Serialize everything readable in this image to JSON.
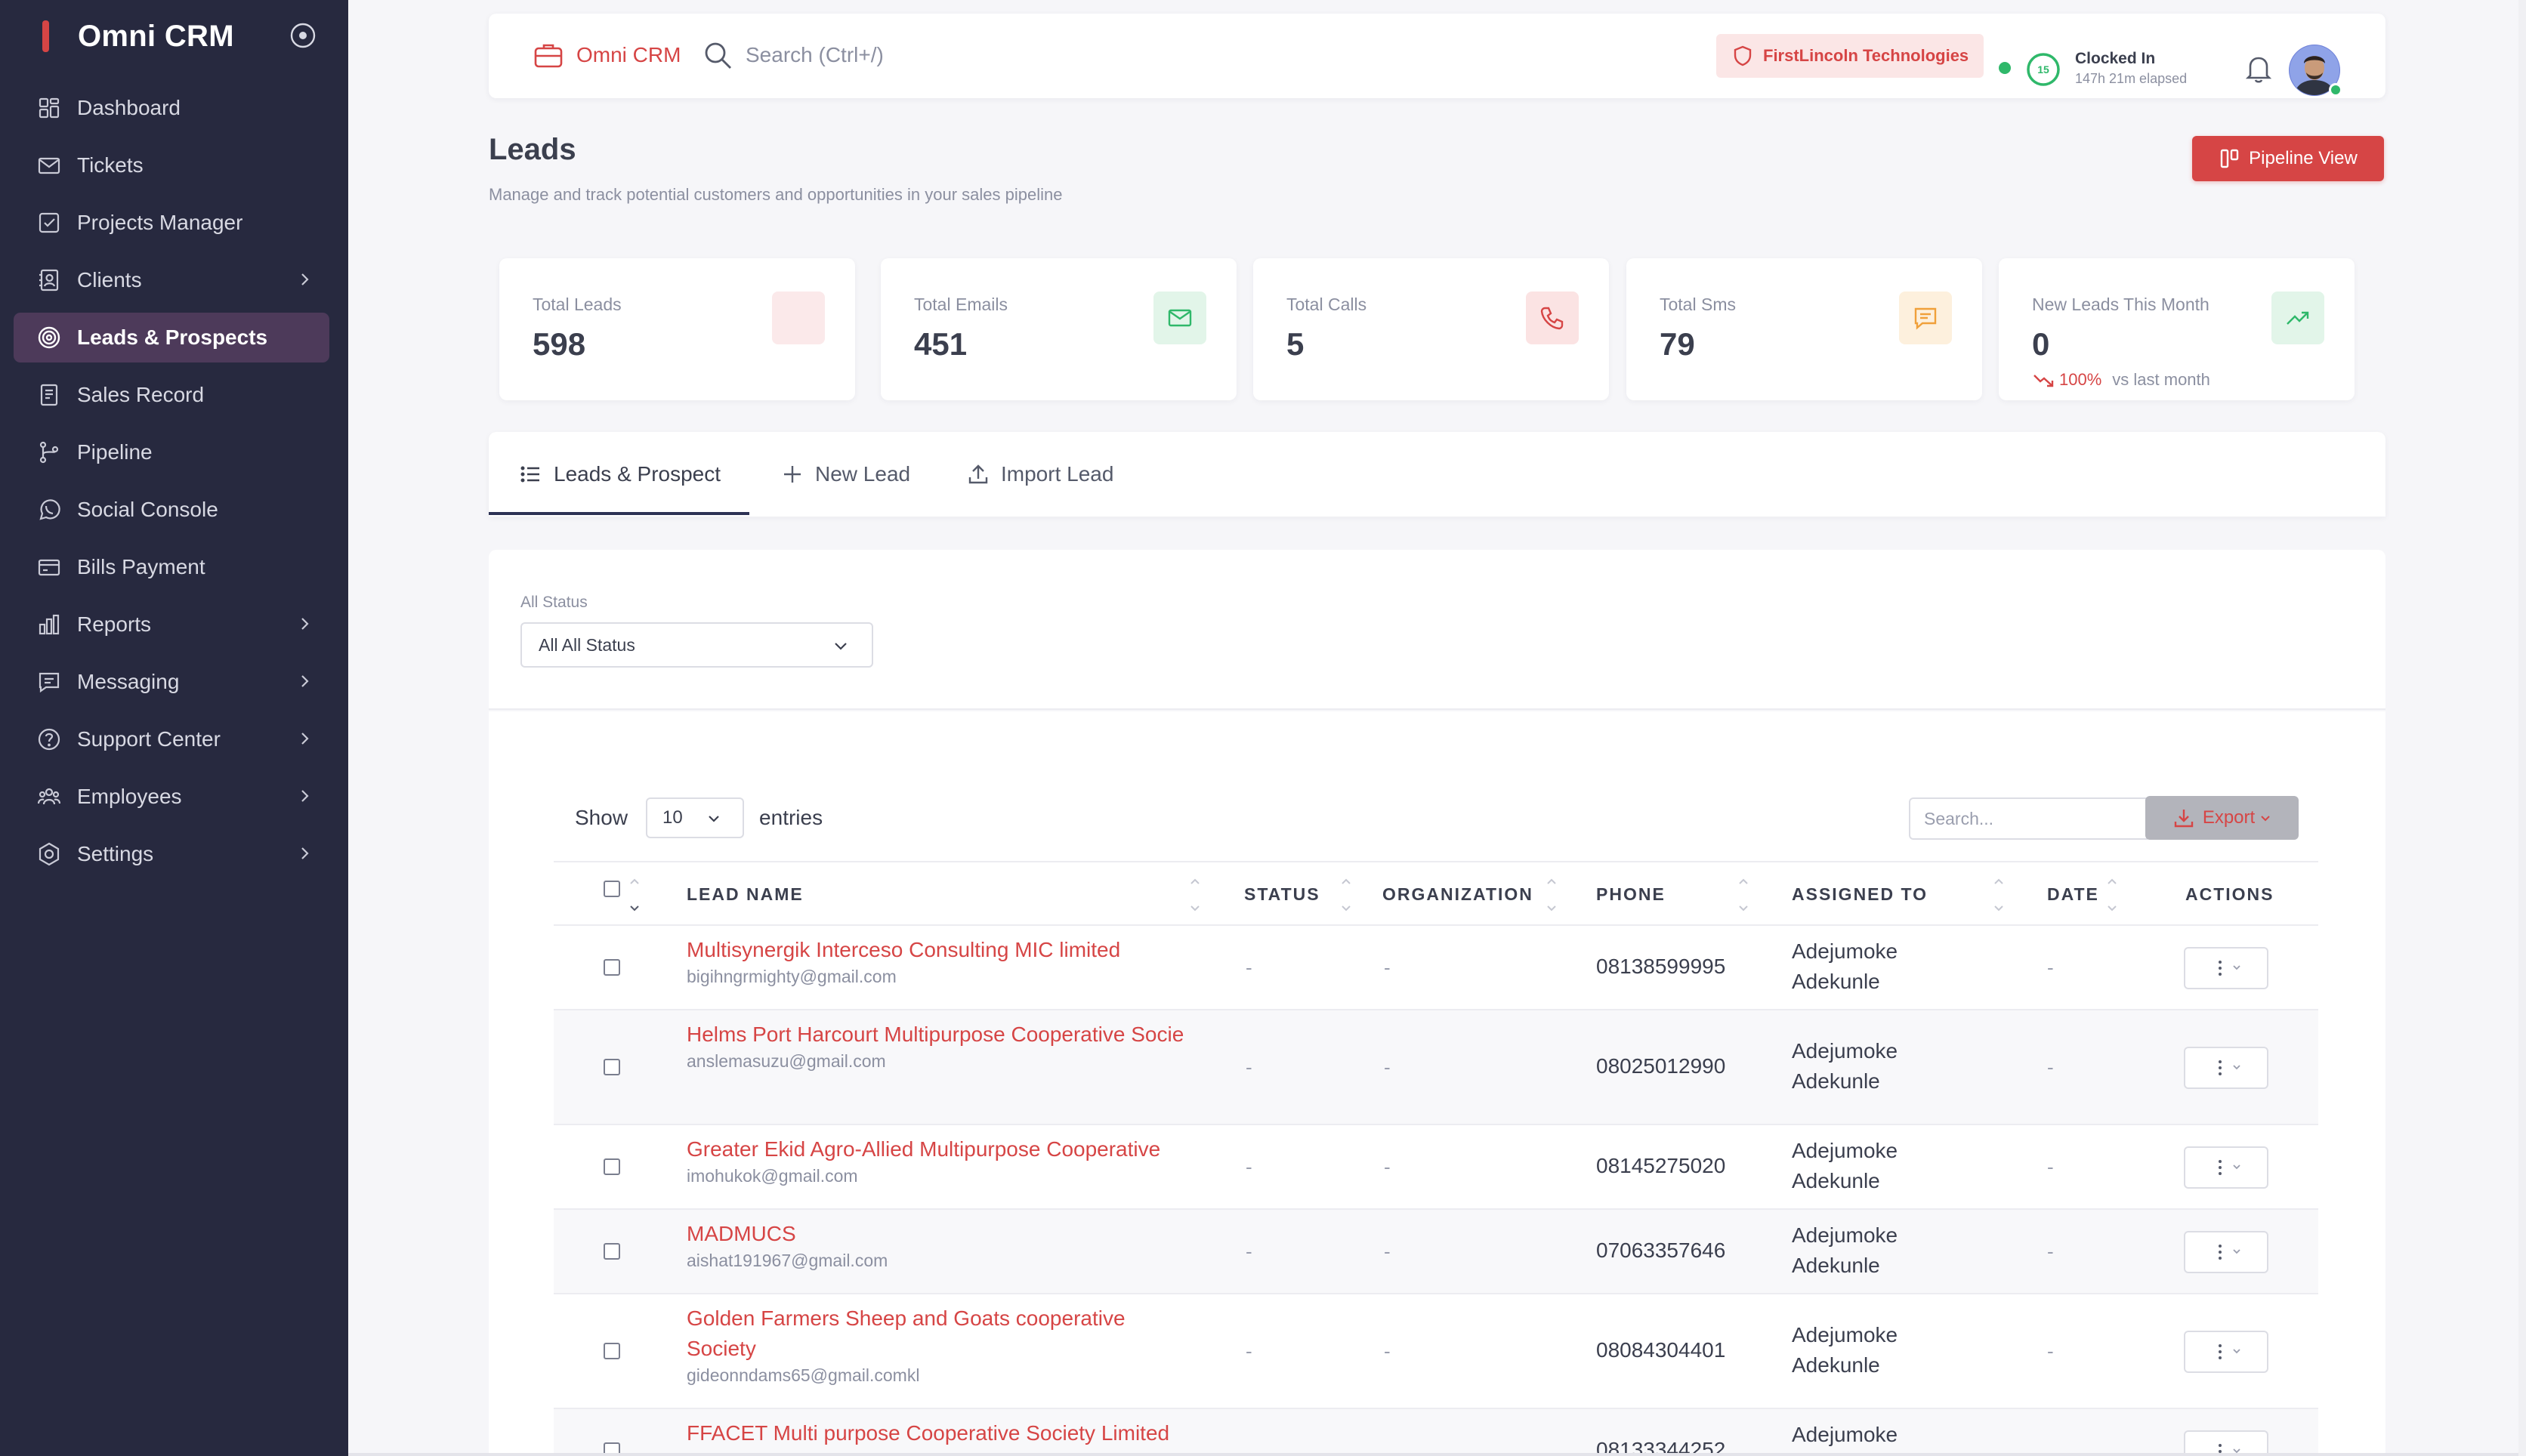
{
  "sidebar": {
    "brand": "Omni CRM",
    "items": [
      {
        "label": "Dashboard",
        "icon": "dashboard-icon",
        "chevron": false,
        "active": false
      },
      {
        "label": "Tickets",
        "icon": "mail-icon",
        "chevron": false,
        "active": false
      },
      {
        "label": "Projects Manager",
        "icon": "checklist-icon",
        "chevron": false,
        "active": false
      },
      {
        "label": "Clients",
        "icon": "contacts-icon",
        "chevron": true,
        "active": false
      },
      {
        "label": "Leads & Prospects",
        "icon": "target-icon",
        "chevron": false,
        "active": true
      },
      {
        "label": "Sales Record",
        "icon": "receipt-icon",
        "chevron": false,
        "active": false
      },
      {
        "label": "Pipeline",
        "icon": "git-branch-icon",
        "chevron": false,
        "active": false
      },
      {
        "label": "Social Console",
        "icon": "whatsapp-icon",
        "chevron": false,
        "active": false
      },
      {
        "label": "Bills Payment",
        "icon": "credit-card-icon",
        "chevron": false,
        "active": false
      },
      {
        "label": "Reports",
        "icon": "bar-chart-icon",
        "chevron": true,
        "active": false
      },
      {
        "label": "Messaging",
        "icon": "message-icon",
        "chevron": true,
        "active": false
      },
      {
        "label": "Support Center",
        "icon": "help-icon",
        "chevron": true,
        "active": false
      },
      {
        "label": "Employees",
        "icon": "users-icon",
        "chevron": true,
        "active": false
      },
      {
        "label": "Settings",
        "icon": "gear-icon",
        "chevron": true,
        "active": false
      }
    ]
  },
  "topbar": {
    "brand": "Omni CRM",
    "search_placeholder": "Search (Ctrl+/)",
    "org": "FirstLincoln Technologies",
    "clock_count": "15",
    "clock_title": "Clocked In",
    "clock_elapsed": "147h 21m elapsed"
  },
  "page": {
    "title": "Leads",
    "subtitle": "Manage and track potential customers and opportunities in your sales pipeline",
    "pipeline_button": "Pipeline View"
  },
  "stats": [
    {
      "label": "Total Leads",
      "value": "598",
      "icon": "blank-icon",
      "bg": "#fbe9ea",
      "fg": "#d64545"
    },
    {
      "label": "Total Emails",
      "value": "451",
      "icon": "mail-icon",
      "bg": "#e2f5e9",
      "fg": "#2fb86a"
    },
    {
      "label": "Total Calls",
      "value": "5",
      "icon": "phone-icon",
      "bg": "#fbe3e3",
      "fg": "#d64545"
    },
    {
      "label": "Total Sms",
      "value": "79",
      "icon": "chat-icon",
      "bg": "#fdf0dd",
      "fg": "#f0a03a"
    },
    {
      "label": "New Leads This Month",
      "value": "0",
      "icon": "trending-up-icon",
      "bg": "#e2f5e9",
      "fg": "#2fb86a",
      "trend_pct": "100%",
      "trend_note": "vs last month"
    }
  ],
  "tabs": [
    {
      "label": "Leads & Prospect",
      "icon": "list-icon",
      "active": true
    },
    {
      "label": "New Lead",
      "icon": "plus-icon",
      "active": false
    },
    {
      "label": "Import Lead",
      "icon": "upload-icon",
      "active": false
    }
  ],
  "filter": {
    "label": "All Status",
    "value": "All All Status"
  },
  "table": {
    "show_label": "Show",
    "page_size": "10",
    "entries_label": "entries",
    "search_placeholder": "Search...",
    "export_label": "Export",
    "columns": [
      "LEAD NAME",
      "STATUS",
      "ORGANIZATION",
      "PHONE",
      "ASSIGNED TO",
      "DATE",
      "ACTIONS"
    ],
    "rows": [
      {
        "name": "Multisynergik Interceso Consulting MIC limited",
        "email": "bigihngrmighty@gmail.com",
        "status": "-",
        "organization": "-",
        "phone": "08138599995",
        "assigned": "Adejumoke Adekunle",
        "date": "-"
      },
      {
        "name": "Helms Port Harcourt Multipurpose Cooperative Socie",
        "email": "anslemasuzu@gmail.com",
        "status": "-",
        "organization": "-",
        "phone": "08025012990",
        "assigned": "Adejumoke Adekunle",
        "date": "-"
      },
      {
        "name": "Greater Ekid Agro-Allied Multipurpose Cooperative",
        "email": "imohukok@gmail.com",
        "status": "-",
        "organization": "-",
        "phone": "08145275020",
        "assigned": "Adejumoke Adekunle",
        "date": "-"
      },
      {
        "name": "MADMUCS",
        "email": "aishat191967@gmail.com",
        "status": "-",
        "organization": "-",
        "phone": "07063357646",
        "assigned": "Adejumoke Adekunle",
        "date": "-"
      },
      {
        "name": "Golden Farmers Sheep and Goats cooperative Society",
        "email": "gideonndams65@gmail.comkl",
        "status": "-",
        "organization": "-",
        "phone": "08084304401",
        "assigned": "Adejumoke Adekunle",
        "date": "-"
      },
      {
        "name": "FFACET Multi purpose Cooperative Society Limited",
        "email": "",
        "status": "",
        "organization": "",
        "phone": "08133344252",
        "assigned": "Adejumoke",
        "date": ""
      }
    ]
  }
}
